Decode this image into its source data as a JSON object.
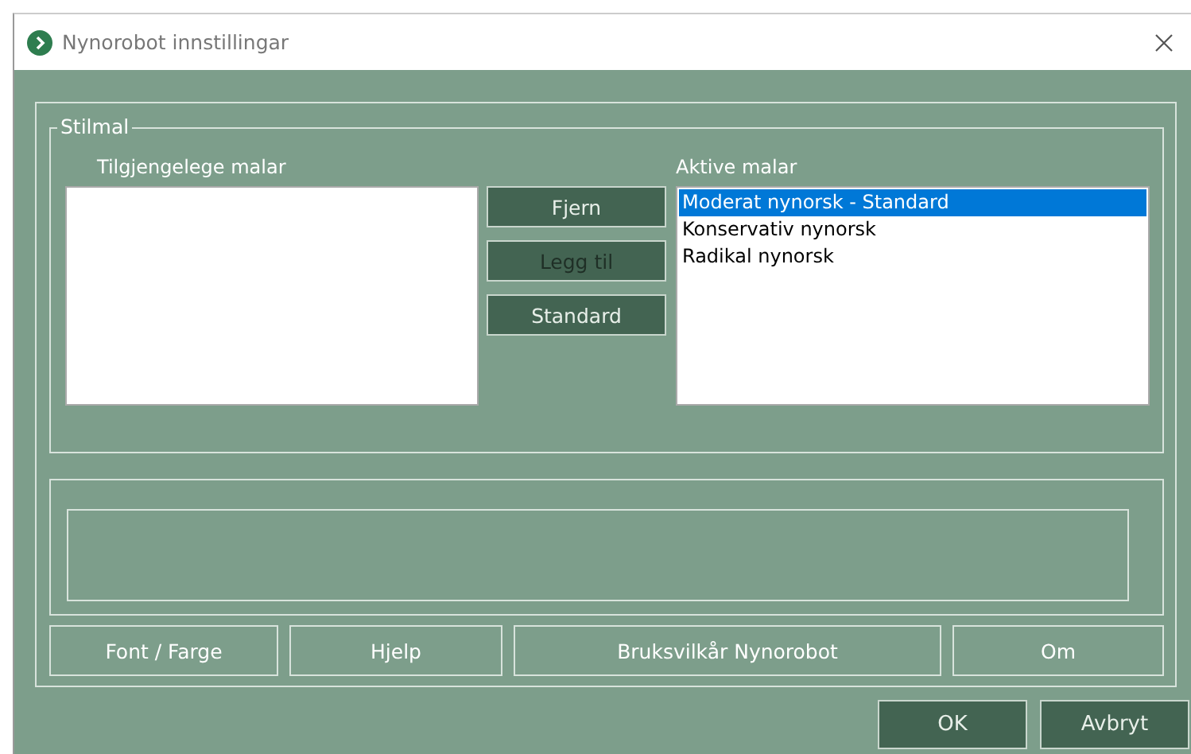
{
  "window": {
    "title": "Nynorobot innstillingar"
  },
  "stilmal": {
    "title": "Stilmal",
    "available_label": "Tilgjengelege malar",
    "active_label": "Aktive malar",
    "buttons": [
      {
        "label": "Fjern",
        "disabled": false
      },
      {
        "label": "Legg til",
        "disabled": true
      },
      {
        "label": "Standard",
        "disabled": false
      }
    ],
    "active_items": [
      {
        "label": "Moderat nynorsk - Standard",
        "selected": true
      },
      {
        "label": "Konservativ nynorsk",
        "selected": false
      },
      {
        "label": "Radikal nynorsk",
        "selected": false
      }
    ]
  },
  "bottom_buttons": [
    "Font / Farge",
    "Hjelp",
    "Bruksvilkår Nynorobot",
    "Om"
  ],
  "dialog_buttons": [
    "OK",
    "Avbryt"
  ]
}
